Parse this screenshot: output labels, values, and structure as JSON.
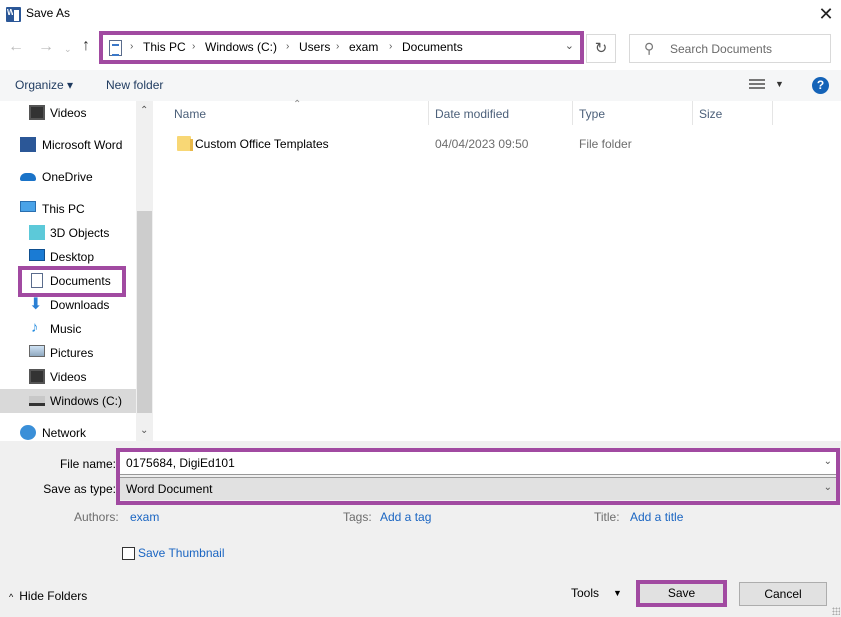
{
  "window": {
    "title": "Save As",
    "close_glyph": "✕"
  },
  "nav": {
    "back_glyph": "←",
    "forward_glyph": "→",
    "recent_glyph": "⌄",
    "up_glyph": "↑",
    "breadcrumbs": [
      "This PC",
      "Windows (C:)",
      "Users",
      "exam",
      "Documents"
    ],
    "separator_glyph": "›",
    "dropdown_glyph": "⌄",
    "refresh_glyph": "↻",
    "search_placeholder": "Search Documents",
    "search_glyph": "⚲"
  },
  "toolbar": {
    "organize_label": "Organize ▾",
    "new_folder_label": "New folder",
    "view_dropdown_glyph": "▼",
    "help_glyph": "?"
  },
  "sidebar": {
    "items": [
      {
        "label": "Videos",
        "icon": "videos-icon"
      },
      {
        "label": "Microsoft Word",
        "icon": "word-icon"
      },
      {
        "label": "OneDrive",
        "icon": "onedrive-icon"
      },
      {
        "label": "This PC",
        "icon": "this-pc-icon"
      },
      {
        "label": "3D Objects",
        "icon": "3d-objects-icon"
      },
      {
        "label": "Desktop",
        "icon": "desktop-icon"
      },
      {
        "label": "Documents",
        "icon": "documents-icon"
      },
      {
        "label": "Downloads",
        "icon": "downloads-icon"
      },
      {
        "label": "Music",
        "icon": "music-icon"
      },
      {
        "label": "Pictures",
        "icon": "pictures-icon"
      },
      {
        "label": "Videos",
        "icon": "videos-icon"
      },
      {
        "label": "Windows (C:)",
        "icon": "drive-icon"
      },
      {
        "label": "Network",
        "icon": "network-icon"
      }
    ],
    "scroll_up_glyph": "⌃",
    "scroll_down_glyph": "⌄"
  },
  "file_list": {
    "columns": [
      "Name",
      "Date modified",
      "Type",
      "Size"
    ],
    "sort_glyph": "⌃",
    "rows": [
      {
        "name": "Custom Office Templates",
        "date_modified": "04/04/2023 09:50",
        "type": "File folder",
        "size": ""
      }
    ]
  },
  "form": {
    "file_name_label": "File name:",
    "file_name_value": "0175684, DigiEd101",
    "save_as_type_label": "Save as type:",
    "save_as_type_value": "Word Document",
    "dropdown_glyph": "⌄",
    "authors_label": "Authors:",
    "authors_value": "exam",
    "tags_label": "Tags:",
    "tags_value": "Add a tag",
    "title_label": "Title:",
    "title_value": "Add a title",
    "save_thumbnail_label": "Save Thumbnail",
    "save_thumbnail_checked": false
  },
  "footer": {
    "hide_folders_glyph": "^",
    "hide_folders_label": "Hide Folders",
    "tools_label": "Tools",
    "tools_drop_glyph": "▼",
    "save_label": "Save",
    "cancel_label": "Cancel"
  },
  "colors": {
    "highlight": "#a14aa1",
    "link": "#1a65c2",
    "help": "#1463b8"
  }
}
